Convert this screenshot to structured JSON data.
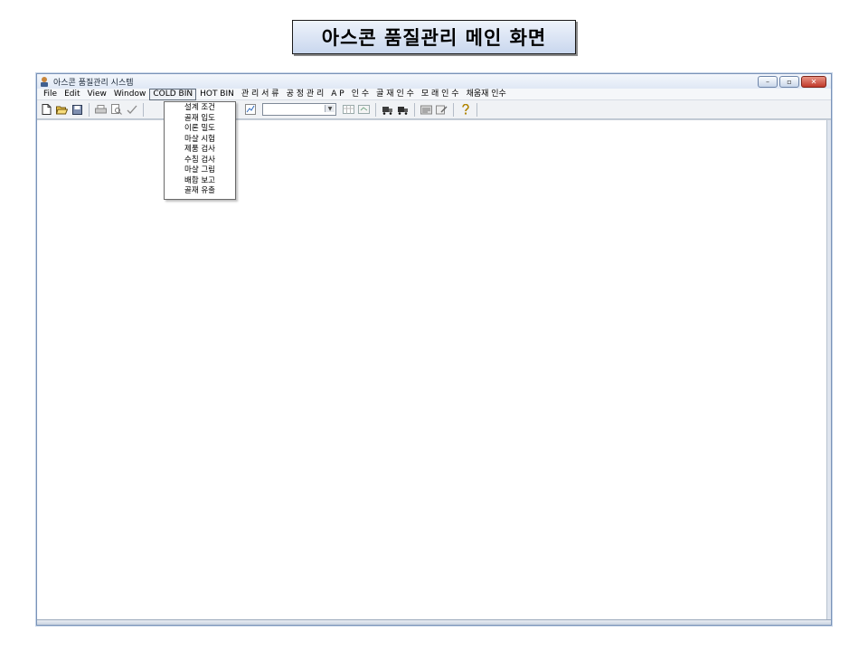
{
  "slide_title": "아스콘 품질관리 메인 화면",
  "window": {
    "title": "아스콘 품질관리 시스템",
    "controls": {
      "minimize": "–",
      "maximize": "▫",
      "close": "✕"
    }
  },
  "menubar": {
    "items": [
      {
        "label": "File"
      },
      {
        "label": "Edit"
      },
      {
        "label": "View"
      },
      {
        "label": "Window"
      },
      {
        "label": "COLD  BIN"
      },
      {
        "label": "HOT  BIN"
      },
      {
        "label": "관 리  서 류"
      },
      {
        "label": "공 정  관 리"
      },
      {
        "label": "A  P"
      },
      {
        "label": "인 수"
      },
      {
        "label": "골  재  인 수"
      },
      {
        "label": "모 래  인 수"
      },
      {
        "label": "채움재 인수"
      }
    ]
  },
  "cold_bin_menu": {
    "items": [
      {
        "label": "설계 조건"
      },
      {
        "label": "골재 입도"
      },
      {
        "label": "이론 밀도"
      },
      {
        "label": "마샬 시험"
      },
      {
        "label": "제품 검사"
      },
      {
        "label": "수침 검사"
      },
      {
        "label": "마샬 그림"
      },
      {
        "label": "배합 보고"
      },
      {
        "label": "골재 유출"
      }
    ]
  },
  "toolbar": {
    "icons": [
      "new-file-icon",
      "open-folder-icon",
      "save-icon",
      "print-icon",
      "print-preview-icon",
      "spell-check-icon",
      "undo-icon",
      "exclamation-icon",
      "chart-icon",
      "grid-icon",
      "export-icon",
      "vehicle-icon",
      "vehicle-icon",
      "report-icon",
      "edit-icon",
      "help-icon"
    ],
    "combo_value": ""
  },
  "colors": {
    "title_gradient_top": "#eef3fb",
    "title_gradient_bottom": "#c9d7ee",
    "window_border": "#7a93b8",
    "close_button": "#c0392b"
  }
}
